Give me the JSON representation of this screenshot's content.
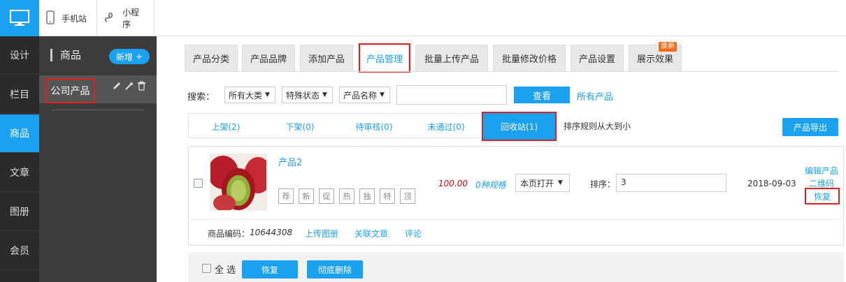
{
  "left_nav": {
    "logo_icon": "monitor-icon",
    "items": [
      {
        "label": "设计"
      },
      {
        "label": "栏目"
      },
      {
        "label": "商品",
        "active": true
      },
      {
        "label": "文章"
      },
      {
        "label": "图册"
      },
      {
        "label": "会员"
      }
    ]
  },
  "top_links": [
    {
      "label": "手机站",
      "icon": "phone-icon"
    },
    {
      "label": "小程序",
      "icon": "mini-program-icon"
    }
  ],
  "sidebar": {
    "title": "商品",
    "add_label": "新增",
    "items": [
      {
        "label": "公司产品",
        "tools": [
          "edit-icon",
          "magic-wand-icon",
          "trash-icon"
        ]
      }
    ]
  },
  "tabs": [
    {
      "label": "产品分类"
    },
    {
      "label": "产品品牌"
    },
    {
      "label": "添加产品"
    },
    {
      "label": "产品管理",
      "active": true
    },
    {
      "label": "批量上传产品"
    },
    {
      "label": "批量修改价格"
    },
    {
      "label": "产品设置"
    },
    {
      "label": "展示效果",
      "badge": "焕新"
    }
  ],
  "search": {
    "label": "搜索：",
    "category_value": "所有大类",
    "status_value": "特殊状态",
    "field_value": "产品名称",
    "input_value": "",
    "button_label": "查看",
    "all_link": "所有产品"
  },
  "status_tabs": [
    {
      "label": "上架(2)"
    },
    {
      "label": "下架(0)"
    },
    {
      "label": "待审核(0)"
    },
    {
      "label": "未通过(0)"
    },
    {
      "label": "回收站(1)",
      "active": true
    }
  ],
  "sort_rule_text": "排序规则从大到小",
  "export_label": "产品导出",
  "product": {
    "name": "产品2",
    "tags": [
      "荐",
      "新",
      "促",
      "热",
      "独",
      "特",
      "顶"
    ],
    "price": "100.00",
    "spec": "0种规格",
    "open_mode": "本页打开",
    "sort_label": "排序：",
    "sort_value": "3",
    "date": "2018-09-03",
    "actions": {
      "edit": "编辑产品",
      "qrcode": "二维码",
      "restore": "恢复"
    },
    "code_label": "商品编码：",
    "code": "10644308",
    "links": [
      "上传图册",
      "关联文章",
      "评论"
    ]
  },
  "bottom": {
    "select_all": "全 选",
    "restore_label": "恢复",
    "delete_label": "彻底删除"
  },
  "colors": {
    "accent": "#1aa1f0",
    "price": "#d9000f",
    "highlight": "#e02020"
  }
}
